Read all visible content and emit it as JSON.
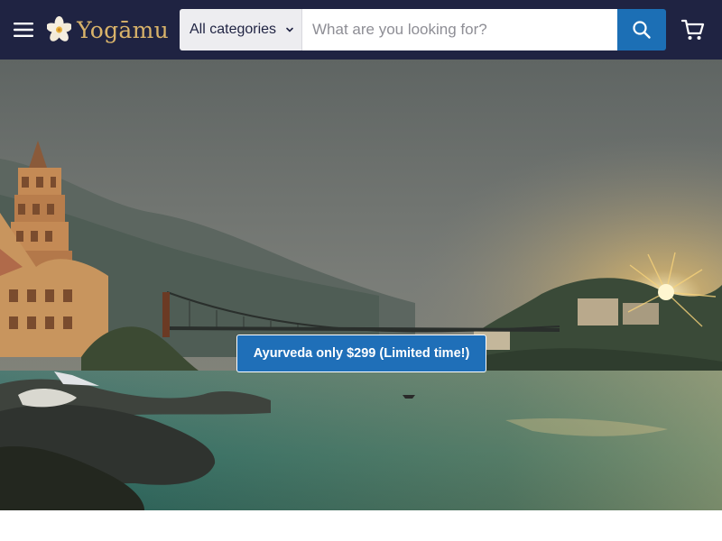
{
  "header": {
    "brand": "Yogāmu",
    "menu_icon": "hamburger-menu-icon",
    "logo_icon": "frangipani-flower-icon",
    "cart_icon": "shopping-cart-icon",
    "background": "#1f2342"
  },
  "search": {
    "category_selected": "All categories",
    "placeholder": "What are you looking for?",
    "button_icon": "search-icon",
    "button_color": "#1c6fb5"
  },
  "hero": {
    "scene": "river-bridge-sunset-photo",
    "promo_label": "Ayurveda only $299 (Limited time!)",
    "promo_color": "#1f6fb8"
  }
}
